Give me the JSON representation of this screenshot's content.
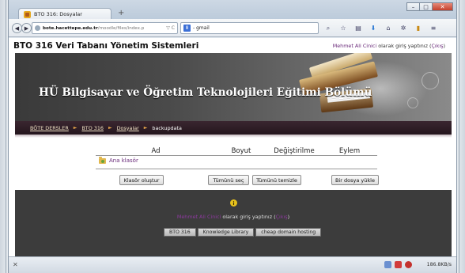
{
  "browser": {
    "tab_title": "BTO 316: Dosyalar",
    "new_tab_symbol": "+",
    "url_host": "bote.hacettepe.edu.tr",
    "url_path": "/moodle/files/index.p",
    "url_suffix": "▽ C",
    "search_engine": "8",
    "search_value": "- gmail",
    "status_speed": "186.8KB/s",
    "status_close": "✕"
  },
  "page": {
    "course_title": "BTO 316 Veri Tabanı Yönetim Sistemleri",
    "login_user": "Mehmet Ali Cinici",
    "login_middle": " olarak giriş yaptınız (",
    "login_logout": "Çıkış",
    "login_end": ")"
  },
  "banner": {
    "title": "HÜ Bilgisayar ve Öğretim Teknolojileri Eğitimi Bölümü"
  },
  "breadcrumb": {
    "items": [
      "BÖTE DERSLER",
      "BTO 316",
      "Dosyalar"
    ],
    "separator": "►",
    "current": "backupdata"
  },
  "files": {
    "headers": [
      "Ad",
      "Boyut",
      "Değiştirilme",
      "Eylem"
    ],
    "parent_folder": "Ana klasör"
  },
  "buttons": {
    "create_folder": "Klasör oluştur",
    "select_all": "Tümünü seç",
    "clear_all": "Tümünü temizle",
    "upload": "Bir dosya yükle"
  },
  "footer": {
    "info_symbol": "i",
    "login_user": "Mehmet Ali Cinici",
    "login_middle": " olarak giriş yaptınız (",
    "login_logout": "Çıkış",
    "login_end": ")",
    "links": [
      "BTO 316",
      "Knowledge Library",
      "cheap domain hosting"
    ]
  }
}
